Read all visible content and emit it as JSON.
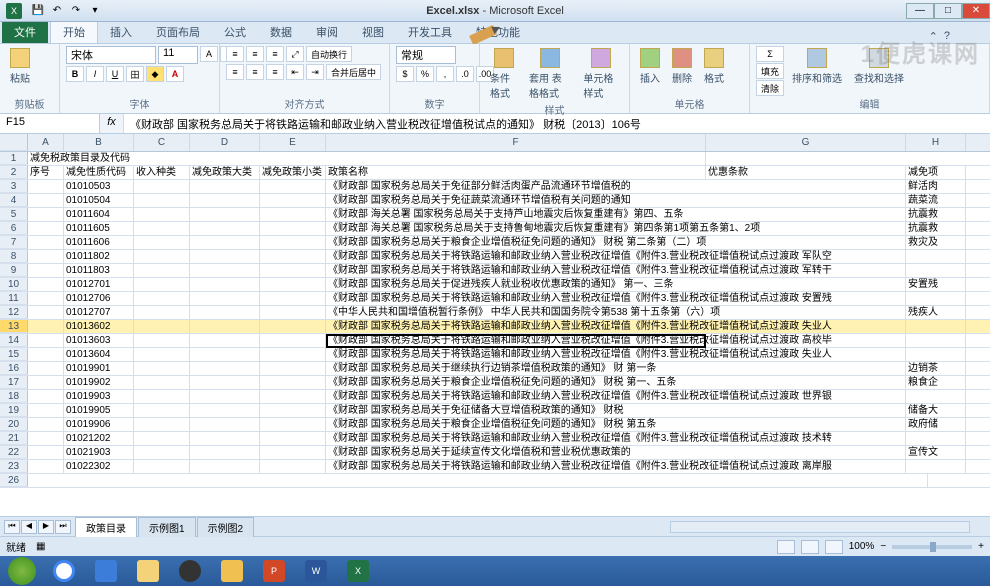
{
  "title": {
    "filename": "Excel.xlsx",
    "app": "Microsoft Excel"
  },
  "tabs": {
    "file": "文件",
    "items": [
      "开始",
      "插入",
      "页面布局",
      "公式",
      "数据",
      "审阅",
      "视图",
      "开发工具",
      "特色功能"
    ],
    "active": 0
  },
  "ribbon": {
    "clipboard": {
      "label": "剪贴板",
      "paste": "粘贴"
    },
    "font": {
      "label": "字体",
      "name": "宋体",
      "size": "11"
    },
    "align": {
      "label": "对齐方式",
      "wrap": "自动换行",
      "merge": "合并后居中"
    },
    "number": {
      "label": "数字",
      "format": "常规"
    },
    "styles": {
      "label": "样式",
      "cond": "条件格式",
      "table": "套用\n表格格式",
      "cell": "单元格\n样式"
    },
    "cells": {
      "label": "单元格",
      "insert": "插入",
      "delete": "删除",
      "format": "格式"
    },
    "editing": {
      "label": "编辑",
      "sum": "Σ",
      "fill": "填充",
      "clear": "清除",
      "sort": "排序和筛选",
      "find": "查找和选择"
    }
  },
  "watermark": "1便虎课网",
  "namebox": "F15",
  "formula": "《财政部 国家税务总局关于将铁路运输和邮政业纳入营业税改征增值税试点的通知》 财税〔2013〕106号",
  "sheet": {
    "row1_title": "减免税政策目录及代码",
    "headers": {
      "A": "序号",
      "B": "减免性质代码",
      "C": "收入种类",
      "D": "减免政策大类",
      "E": "减免政策小类",
      "F": "政策名称",
      "G": "优惠条款",
      "H": "减免项"
    },
    "rows": [
      {
        "r": 3,
        "b": "01010503",
        "f": "《财政部 国家税务总局关于免征部分鲜活肉蛋产品流通环节增值税的",
        "h": "鲜活肉"
      },
      {
        "r": 4,
        "b": "01010504",
        "f": "《财政部 国家税务总局关于免征蔬菜流通环节增值税有关问题的通知",
        "h": "蔬菜流"
      },
      {
        "r": 5,
        "b": "01011604",
        "f": "《财政部 海关总署 国家税务总局关于支持芦山地震灾后恢复重建有》第四、五条",
        "h": "抗震救"
      },
      {
        "r": 6,
        "b": "01011605",
        "f": "《财政部 海关总署 国家税务总局关于支持鲁甸地震灾后恢复重建有》第四条第1项第五条第1、2项",
        "h": "抗震救"
      },
      {
        "r": 7,
        "b": "01011606",
        "f": "《财政部 国家税务总局关于粮食企业增值税征免问题的通知》 财税 第二条第（二）项",
        "h": "救灾及"
      },
      {
        "r": 8,
        "b": "01011802",
        "f": "《财政部 国家税务总局关于将铁路运输和邮政业纳入营业税改征增值《附件3.营业税改征增值税试点过渡政 军队空"
      },
      {
        "r": 9,
        "b": "01011803",
        "f": "《财政部 国家税务总局关于将铁路运输和邮政业纳入营业税改征增值《附件3.营业税改征增值税试点过渡政 军转干"
      },
      {
        "r": 10,
        "b": "01012701",
        "f": "《财政部 国家税务总局关于促进残疾人就业税收优惠政策的通知》 第一、三条",
        "h": "安置残"
      },
      {
        "r": 11,
        "b": "01012706",
        "f": "《财政部 国家税务总局关于将铁路运输和邮政业纳入营业税改征增值《附件3.营业税改征增值税试点过渡政 安置残"
      },
      {
        "r": 12,
        "b": "01012707",
        "f": "《中华人民共和国增值税暂行条例》 中华人民共和国国务院令第538 第十五条第（六）项",
        "h": "残疾人"
      },
      {
        "r": 13,
        "b": "01013602",
        "f": "《财政部 国家税务总局关于将铁路运输和邮政业纳入营业税改征增值《附件3.营业税改征增值税试点过渡政 失业人",
        "hl": true
      },
      {
        "r": 14,
        "b": "01013603",
        "f": "《财政部 国家税务总局关于将铁路运输和邮政业纳入营业税改征增值《附件3.营业税改征增值税试点过渡政 高校毕"
      },
      {
        "r": 15,
        "b": "01013604",
        "f": "《财政部 国家税务总局关于将铁路运输和邮政业纳入营业税改征增值《附件3.营业税改征增值税试点过渡政 失业人"
      },
      {
        "r": 16,
        "b": "01019901",
        "f": "《财政部 国家税务总局关于继续执行边销茶增值税政策的通知》 财 第一条",
        "h": "边销茶"
      },
      {
        "r": 17,
        "b": "01019902",
        "f": "《财政部 国家税务总局关于粮食企业增值税征免问题的通知》 财税 第一、五条",
        "h": "粮食企"
      },
      {
        "r": 18,
        "b": "01019903",
        "f": "《财政部 国家税务总局关于将铁路运输和邮政业纳入营业税改征增值《附件3.营业税改征增值税试点过渡政 世界银"
      },
      {
        "r": 19,
        "b": "01019905",
        "f": "《财政部 国家税务总局关于免征储备大豆增值税政策的通知》 财税",
        "h": "储备大"
      },
      {
        "r": 20,
        "b": "01019906",
        "f": "《财政部 国家税务总局关于粮食企业增值税征免问题的通知》 财税 第五条",
        "h": "政府储"
      },
      {
        "r": 21,
        "b": "01021202",
        "f": "《财政部 国家税务总局关于将铁路运输和邮政业纳入营业税改征增值《附件3.营业税改征增值税试点过渡政 技术转"
      },
      {
        "r": 22,
        "b": "01021903",
        "f": "《财政部 国家税务总局关于延续宣传文化增值税和营业税优惠政策的",
        "h": "宣传文"
      },
      {
        "r": 23,
        "b": "01022302",
        "f": "《财政部 国家税务总局关于将铁路运输和邮政业纳入营业税改征增值《附件3.营业税改征增值税试点过渡政 离岸服"
      }
    ],
    "firstRowNum": 1,
    "tabs": [
      "政策目录",
      "示例图1",
      "示例图2"
    ],
    "activeTab": 0
  },
  "status": {
    "ready": "就绪",
    "zoom": "100%"
  },
  "cols": [
    "A",
    "B",
    "C",
    "D",
    "E",
    "F",
    "",
    "G",
    "H"
  ]
}
